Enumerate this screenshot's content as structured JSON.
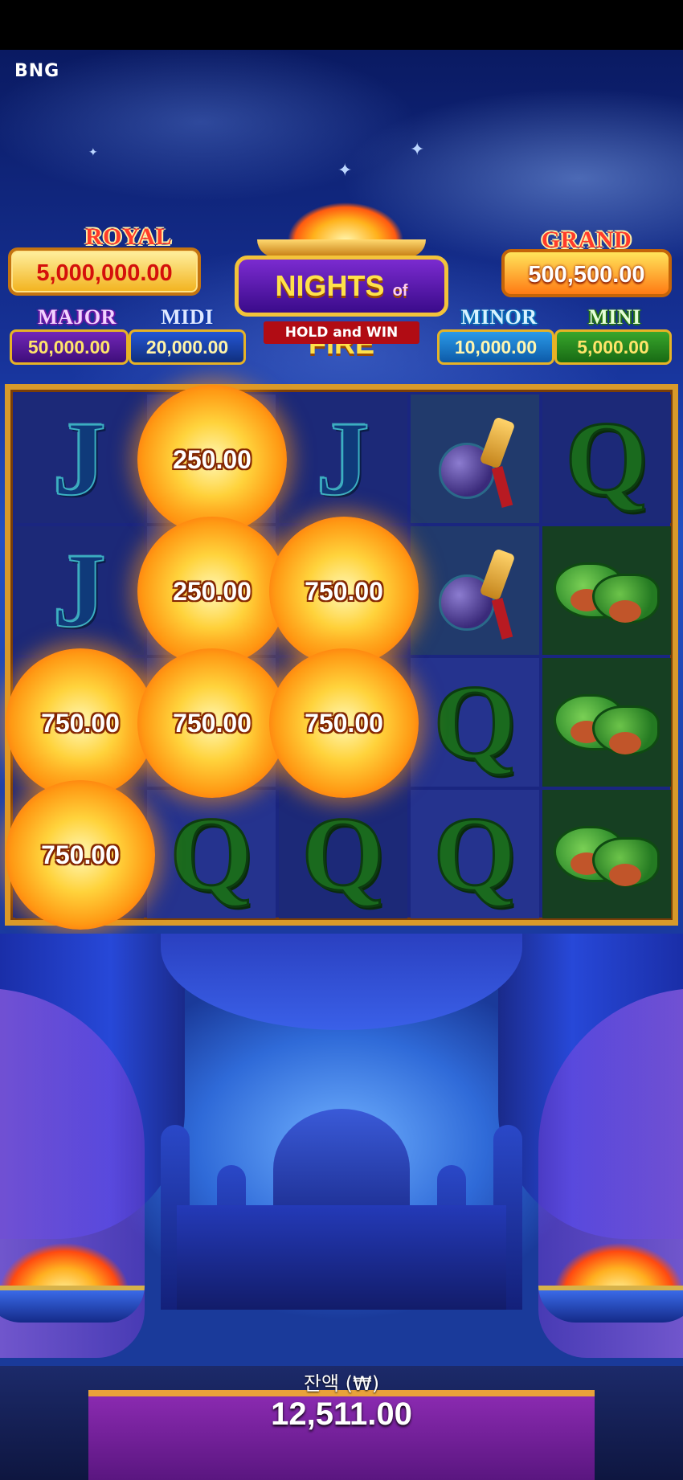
{
  "provider": "BNG",
  "game": {
    "title_main": "NIGHTS",
    "title_of": "of",
    "title_fire": "FIRE",
    "subtitle": "HOLD and WIN"
  },
  "jackpots": {
    "royal": {
      "label": "ROYAL",
      "value": "5,000,000.00"
    },
    "grand": {
      "label": "GRAND",
      "value": "500,500.00"
    },
    "major": {
      "label": "MAJOR",
      "value": "50,000.00"
    },
    "midi": {
      "label": "MIDI",
      "value": "20,000.00"
    },
    "minor": {
      "label": "MINOR",
      "value": "10,000.00"
    },
    "mini": {
      "label": "MINI",
      "value": "5,000.00"
    }
  },
  "reels": {
    "symbols": {
      "r0": [
        "J",
        "",
        "J",
        "potion",
        "Q"
      ],
      "r1": [
        "J",
        "",
        "",
        "potion",
        "shoes"
      ],
      "r2": [
        "",
        "",
        "",
        "Q",
        "shoes"
      ],
      "r3": [
        "",
        "Q",
        "Q",
        "Q",
        "shoes"
      ]
    },
    "orbs": [
      {
        "row": 0,
        "col": 1,
        "value": "250.00"
      },
      {
        "row": 1,
        "col": 1,
        "value": "250.00"
      },
      {
        "row": 1,
        "col": 2,
        "value": "750.00"
      },
      {
        "row": 2,
        "col": 0,
        "value": "750.00"
      },
      {
        "row": 2,
        "col": 1,
        "value": "750.00"
      },
      {
        "row": 2,
        "col": 2,
        "value": "750.00"
      },
      {
        "row": 3,
        "col": 0,
        "value": "750.00"
      }
    ]
  },
  "balance": {
    "label": "잔액 (₩)",
    "value": "12,511.00"
  }
}
